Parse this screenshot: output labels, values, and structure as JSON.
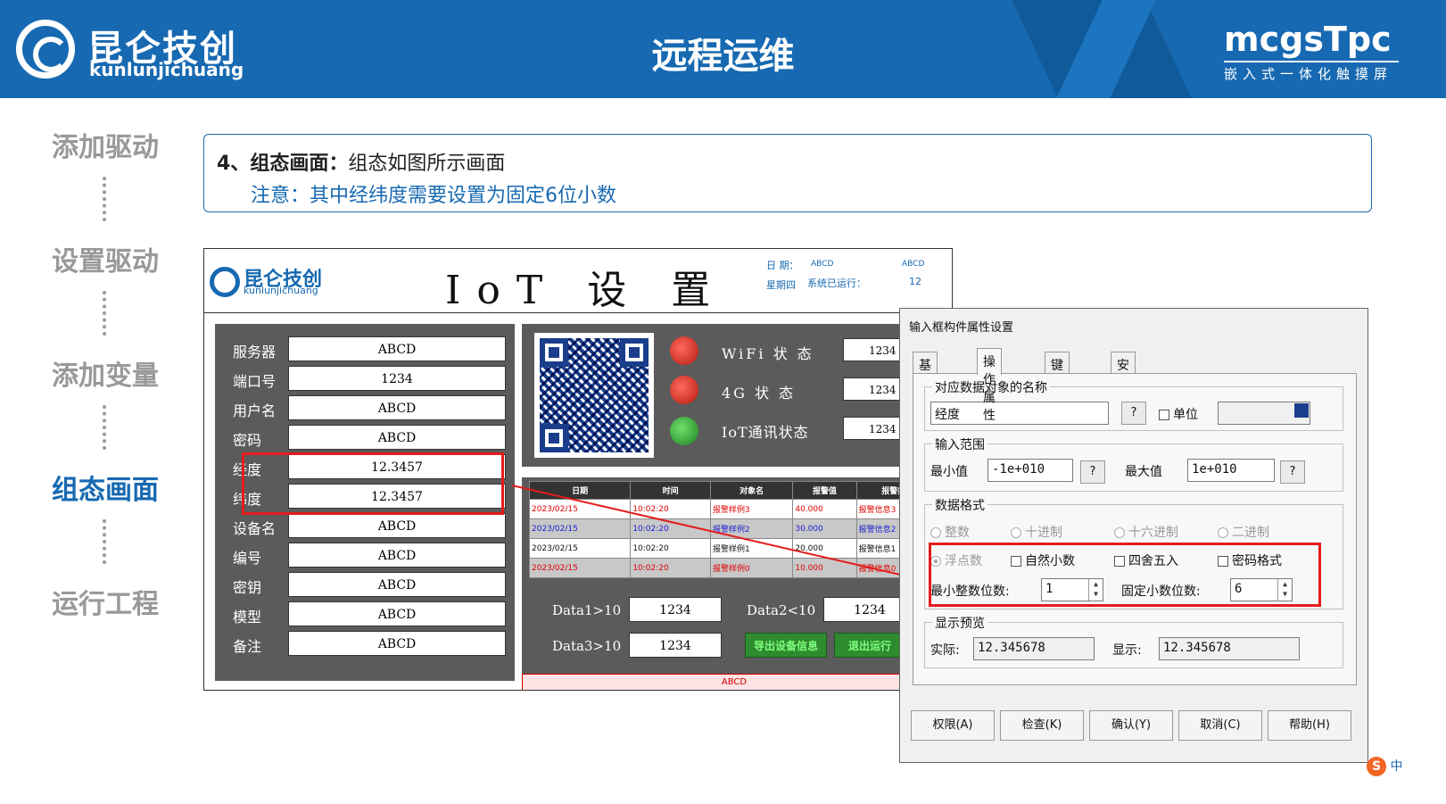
{
  "header": {
    "brand_cn": "昆仑技创",
    "brand_en": "kunlunjichuang",
    "title": "远程运维",
    "product": "mcgsTpc",
    "product_sub": "嵌入式一体化触摸屏"
  },
  "steps": [
    "添加驱动",
    "设置驱动",
    "添加变量",
    "组态画面",
    "运行工程"
  ],
  "active_step": "组态画面",
  "note": {
    "prefix": "4、",
    "bold": "组态画面",
    "colon": "：",
    "text": "组态如图所示画面",
    "note2": "注意：其中经纬度需要设置为固定6位小数"
  },
  "iot": {
    "brand_cn": "昆仑技创",
    "brand_en": "kunlunjichuang",
    "title": "IoT 设 置",
    "date_label": "日 期：",
    "date_val": "ABCD",
    "date_right": "ABCD",
    "week_label": "星期四",
    "run_label": "系统已运行：",
    "run_val": "12",
    "fields": [
      {
        "label": "服务器",
        "value": "ABCD"
      },
      {
        "label": "端口号",
        "value": "1234"
      },
      {
        "label": "用户名",
        "value": "ABCD"
      },
      {
        "label": "密码",
        "value": "ABCD"
      },
      {
        "label": "经度",
        "value": "12.3457"
      },
      {
        "label": "纬度",
        "value": "12.3457"
      },
      {
        "label": "设备名",
        "value": "ABCD"
      },
      {
        "label": "编号",
        "value": "ABCD"
      },
      {
        "label": "密钥",
        "value": "ABCD"
      },
      {
        "label": "模型",
        "value": "ABCD"
      },
      {
        "label": "备注",
        "value": "ABCD"
      }
    ],
    "status": [
      {
        "label": "WiFi 状 态",
        "value": "1234",
        "led": "red"
      },
      {
        "label": "4G  状  态",
        "value": "1234",
        "led": "red"
      },
      {
        "label": "IoT通讯状态",
        "value": "1234",
        "led": "green"
      }
    ],
    "alarm_headers": [
      "日期",
      "时间",
      "对象名",
      "报警值",
      "报警描述"
    ],
    "alarm_rows": [
      {
        "date": "2023/02/15",
        "time": "10:02:20",
        "obj": "报警样例3",
        "val": "40.000",
        "desc": "报警信息3",
        "color": "#e00000",
        "bg": "#ffffff"
      },
      {
        "date": "2023/02/15",
        "time": "10:02:20",
        "obj": "报警样例2",
        "val": "30.000",
        "desc": "报警信息2",
        "color": "#2020d0",
        "bg": "#c8c8c8"
      },
      {
        "date": "2023/02/15",
        "time": "10:02:20",
        "obj": "报警样例1",
        "val": "20.000",
        "desc": "报警信息1",
        "color": "#111111",
        "bg": "#ffffff"
      },
      {
        "date": "2023/02/15",
        "time": "10:02:20",
        "obj": "报警样例0",
        "val": "10.000",
        "desc": "报警信息0",
        "color": "#e00000",
        "bg": "#c8c8c8"
      }
    ],
    "data1_label": "Data1>10",
    "data1_val": "1234",
    "data2_label": "Data2<10",
    "data2_val": "1234",
    "data3_label": "Data3>10",
    "data3_val": "1234",
    "export_btn": "导出设备信息",
    "exit_btn": "退出运行",
    "bottom_bar": "ABCD"
  },
  "dialog": {
    "title": "输入框构件属性设置",
    "tabs": [
      "基本属性",
      "操作属性",
      "键盘属性",
      "安全属性"
    ],
    "active_tab": "操作属性",
    "grp_name": "对应数据对象的名称",
    "name_val": "经度",
    "unit_label": "单位",
    "grp_range": "输入范围",
    "min_label": "最小值",
    "min_val": "-1e+010",
    "max_label": "最大值",
    "max_val": "1e+010",
    "grp_format": "数据格式",
    "radio_int": "整数",
    "radio_dec": "十进制",
    "radio_hex": "十六进制",
    "radio_bin": "二进制",
    "radio_float": "浮点数",
    "chk_natural": "自然小数",
    "chk_round": "四舍五入",
    "chk_pwd": "密码格式",
    "min_int_label": "最小整数位数:",
    "min_int_val": "1",
    "fix_dec_label": "固定小数位数:",
    "fix_dec_val": "6",
    "grp_preview": "显示预览",
    "actual_label": "实际:",
    "actual_val": "12.345678",
    "display_label": "显示:",
    "display_val": "12.345678",
    "btn_perm": "权限(A)",
    "btn_check": "检查(K)",
    "btn_ok": "确认(Y)",
    "btn_cancel": "取消(C)",
    "btn_help": "帮助(H)",
    "question": "?"
  },
  "ime": {
    "lang": "中"
  },
  "colors": {
    "brand_blue": "#1769b1",
    "highlight_red": "#e41c1c"
  }
}
